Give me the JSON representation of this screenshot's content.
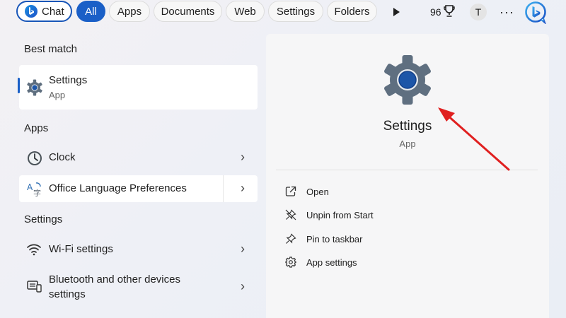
{
  "filters": {
    "chat": "Chat",
    "all": "All",
    "apps": "Apps",
    "documents": "Documents",
    "web": "Web",
    "settings": "Settings",
    "folders": "Folders",
    "points": "96",
    "avatar_initial": "T",
    "more": "···"
  },
  "best_match": {
    "heading": "Best match",
    "title": "Settings",
    "subtitle": "App",
    "icon": "settings-gear-icon"
  },
  "apps": {
    "heading": "Apps",
    "items": [
      {
        "label": "Clock",
        "icon": "clock-icon"
      },
      {
        "label": "Office Language Preferences",
        "icon": "language-icon"
      }
    ]
  },
  "settings_section": {
    "heading": "Settings",
    "items": [
      {
        "label": "Wi-Fi settings",
        "icon": "wifi-icon"
      },
      {
        "label_line1": "Bluetooth and other devices",
        "label_line2": "settings",
        "icon": "bluetooth-devices-icon"
      }
    ]
  },
  "detail": {
    "title": "Settings",
    "subtitle": "App",
    "actions": [
      {
        "label": "Open",
        "icon": "open-external-icon"
      },
      {
        "label": "Unpin from Start",
        "icon": "unpin-icon"
      },
      {
        "label": "Pin to taskbar",
        "icon": "pin-icon"
      },
      {
        "label": "App settings",
        "icon": "gear-icon"
      }
    ]
  },
  "colors": {
    "accent": "#1a5fc7",
    "annotation_arrow": "#e02020"
  }
}
